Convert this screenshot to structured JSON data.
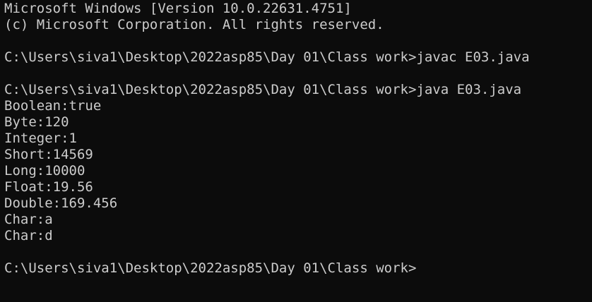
{
  "window": {
    "type": "command-prompt"
  },
  "colors": {
    "background": "#0c0c0c",
    "foreground": "#cccccc"
  },
  "lines": [
    "Microsoft Windows [Version 10.0.22631.4751]",
    "(c) Microsoft Corporation. All rights reserved.",
    "",
    "C:\\Users\\siva1\\Desktop\\2022asp85\\Day 01\\Class work>javac E03.java",
    "",
    "C:\\Users\\siva1\\Desktop\\2022asp85\\Day 01\\Class work>java E03.java",
    "Boolean:true",
    "Byte:120",
    "Integer:1",
    "Short:14569",
    "Long:10000",
    "Float:19.56",
    "Double:169.456",
    "Char:a",
    "Char:d",
    "",
    "C:\\Users\\siva1\\Desktop\\2022asp85\\Day 01\\Class work>"
  ]
}
